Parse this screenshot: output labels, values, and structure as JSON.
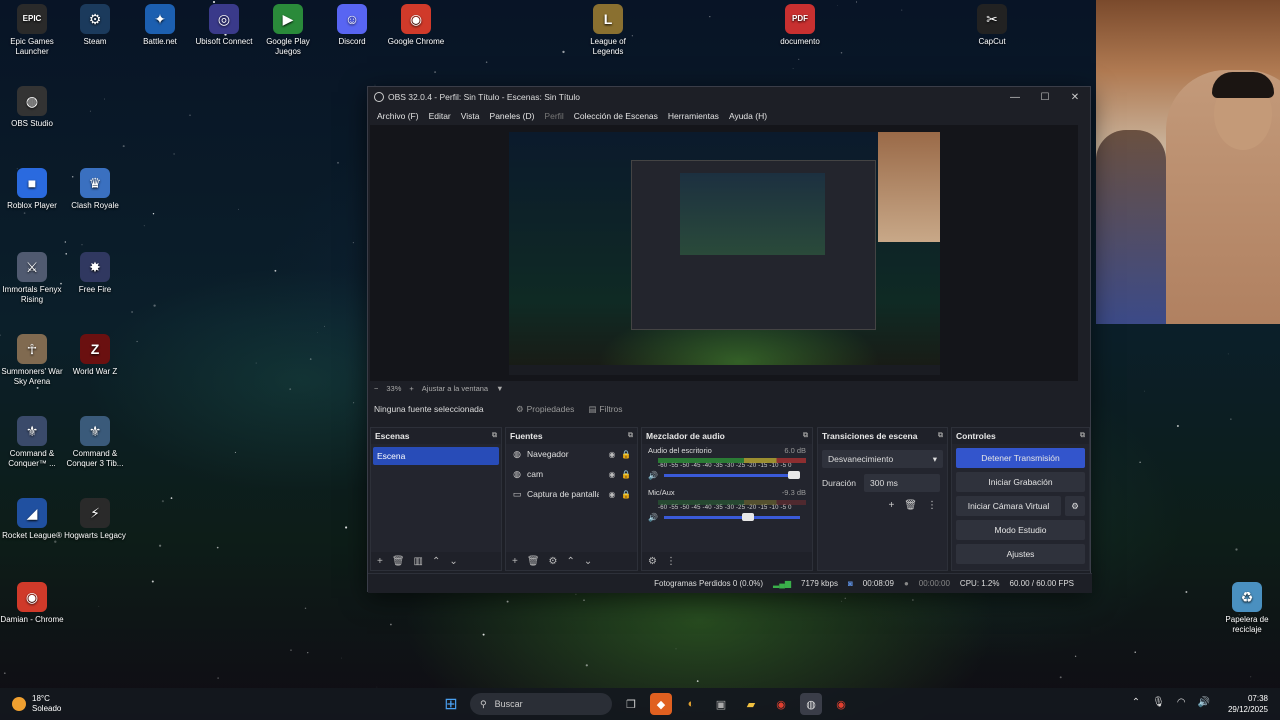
{
  "desktop_icons": [
    {
      "label": "Epic Games Launcher",
      "icon": "epic-games-icon",
      "glyph": "EPIC",
      "color": "#2a2a2a"
    },
    {
      "label": "Steam",
      "icon": "steam-icon",
      "glyph": "⚙",
      "color": "#1b3a5c"
    },
    {
      "label": "Battle.net",
      "icon": "battlenet-icon",
      "glyph": "✦",
      "color": "#1c5fb0"
    },
    {
      "label": "Ubisoft Connect",
      "icon": "ubisoft-icon",
      "glyph": "◎",
      "color": "#3a3a8a"
    },
    {
      "label": "Google Play Juegos",
      "icon": "google-play-icon",
      "glyph": "▶",
      "color": "#2a8a3a"
    },
    {
      "label": "Discord",
      "icon": "discord-icon",
      "glyph": "☺",
      "color": "#5865f2"
    },
    {
      "label": "Google Chrome",
      "icon": "chrome-icon",
      "glyph": "◉",
      "color": "#d03a2a"
    },
    {
      "label": "League of Legends",
      "icon": "league-icon",
      "glyph": "L",
      "color": "#8a7030"
    },
    {
      "label": "documento",
      "icon": "pdf-icon",
      "glyph": "PDF",
      "color": "#c83030"
    },
    {
      "label": "CapCut",
      "icon": "capcut-icon",
      "glyph": "✂",
      "color": "#222"
    },
    {
      "label": "OBS Studio",
      "icon": "obs-icon",
      "glyph": "◍",
      "color": "#333"
    },
    {
      "label": "Roblox Player",
      "icon": "roblox-icon",
      "glyph": "■",
      "color": "#2a6adf"
    },
    {
      "label": "Clash Royale",
      "icon": "clash-royale-icon",
      "glyph": "♛",
      "color": "#3a70c0"
    },
    {
      "label": "Immortals Fenyx Rising",
      "icon": "immortals-icon",
      "glyph": "⚔",
      "color": "#505a70"
    },
    {
      "label": "Free Fire",
      "icon": "free-fire-icon",
      "glyph": "✸",
      "color": "#303860"
    },
    {
      "label": "Summoners' War Sky Arena",
      "icon": "summoners-war-icon",
      "glyph": "☥",
      "color": "#806a50"
    },
    {
      "label": "World War Z",
      "icon": "world-war-z-icon",
      "glyph": "Z",
      "color": "#6a1010"
    },
    {
      "label": "Command & Conquer™ ...",
      "icon": "command-conquer-icon",
      "glyph": "⚜",
      "color": "#3a4a6a"
    },
    {
      "label": "Command & Conquer 3 Tib...",
      "icon": "command-conquer-3-icon",
      "glyph": "⚜",
      "color": "#3a5a7a"
    },
    {
      "label": "Rocket League®",
      "icon": "rocket-league-icon",
      "glyph": "◢",
      "color": "#2050a0"
    },
    {
      "label": "Hogwarts Legacy",
      "icon": "hogwarts-icon",
      "glyph": "⚡",
      "color": "#2a2a2a"
    },
    {
      "label": "Damian - Chrome",
      "icon": "chrome-profile-icon",
      "glyph": "◉",
      "color": "#d03a2a"
    },
    {
      "label": "Papelera de reciclaje",
      "icon": "recycle-bin-icon",
      "glyph": "♻",
      "color": "#4a90c0"
    }
  ],
  "obs": {
    "title": "OBS 32.0.4 - Perfil: Sin Título - Escenas: Sin Título",
    "menu": {
      "archivo": "Archivo (F)",
      "editar": "Editar",
      "vista": "Vista",
      "paneles": "Paneles (D)",
      "perfil": "Perfil",
      "coleccion": "Colección de Escenas",
      "herramientas": "Herramientas",
      "ayuda": "Ayuda (H)"
    },
    "zoom": {
      "minus": "−",
      "level": "33%",
      "plus": "+",
      "fit": "Ajustar a la ventana"
    },
    "source_bar": {
      "none": "Ninguna fuente seleccionada",
      "properties": "Propiedades",
      "filters": "Filtros"
    },
    "scenes": {
      "title": "Escenas",
      "items": [
        "Escena"
      ]
    },
    "sources": {
      "title": "Fuentes",
      "items": [
        {
          "label": "Navegador",
          "icon": "browser-source-icon"
        },
        {
          "label": "cam",
          "icon": "camera-source-icon"
        },
        {
          "label": "Captura de pantalla",
          "icon": "display-capture-icon"
        }
      ]
    },
    "mixer": {
      "title": "Mezclador de audio",
      "channels": [
        {
          "name": "Audio del escritorio",
          "db": "6.0 dB",
          "level": 0.7,
          "volume": 1.0
        },
        {
          "name": "Mic/Aux",
          "db": "-9.3 dB",
          "level": 0.0,
          "volume": 0.66
        }
      ],
      "ticks": "-60 -55 -50 -45 -40 -35 -30 -25 -20 -15 -10 -5 0"
    },
    "transitions": {
      "title": "Transiciones de escena",
      "selected": "Desvanecimiento",
      "duration_label": "Duración",
      "duration": "300 ms"
    },
    "controls": {
      "title": "Controles",
      "stop_stream": "Detener Transmisión",
      "start_record": "Iniciar Grabación",
      "virtual_cam": "Iniciar Cámara Virtual",
      "studio_mode": "Modo Estudio",
      "settings": "Ajustes"
    },
    "status": {
      "dropped": "Fotogramas Perdidos 0 (0.0%)",
      "bitrate": "7179 kbps",
      "stream_time": "00:08:09",
      "rec_time": "00:00:00",
      "cpu": "CPU: 1.2%",
      "fps": "60.00 / 60.00 FPS"
    },
    "accent": "#3355cc"
  },
  "taskbar": {
    "temp": "18°C",
    "weather": "Soleado",
    "search_placeholder": "Buscar",
    "time": "07:38",
    "date": "29/12/2025"
  }
}
